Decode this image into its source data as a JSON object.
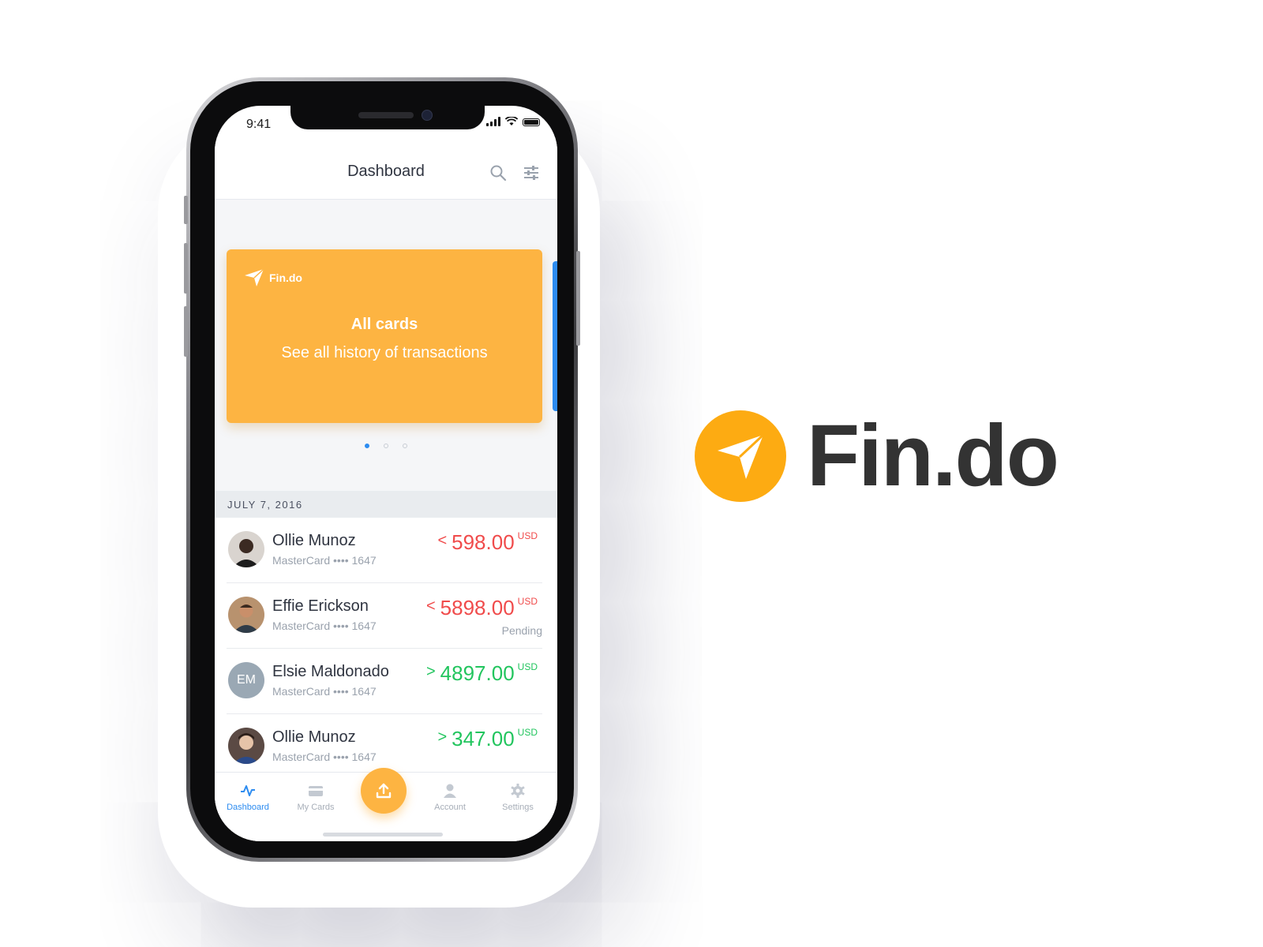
{
  "status_bar": {
    "time": "9:41"
  },
  "header": {
    "title": "Dashboard",
    "search_icon": "search-icon",
    "filter_icon": "sliders-icon"
  },
  "card": {
    "logo_text": "Fin.do",
    "title": "All cards",
    "subtitle": "See all history of transactions",
    "color": "#fdb442",
    "carousel_position": 1,
    "carousel_count": 3
  },
  "date_header": "JULY 7, 2016",
  "transactions": [
    {
      "name": "Ollie Munoz",
      "card": "MasterCard •••• 1647",
      "direction": "<",
      "amount": "598.00",
      "currency": "USD",
      "status": "",
      "type": "outgoing"
    },
    {
      "name": "Effie Erickson",
      "card": "MasterCard •••• 1647",
      "direction": "<",
      "amount": "5898.00",
      "currency": "USD",
      "status": "Pending",
      "type": "outgoing"
    },
    {
      "name": "Elsie Maldonado",
      "initials": "EM",
      "card": "MasterCard •••• 1647",
      "direction": ">",
      "amount": "4897.00",
      "currency": "USD",
      "status": "",
      "type": "incoming"
    },
    {
      "name": "Ollie Munoz",
      "card": "MasterCard •••• 1647",
      "direction": ">",
      "amount": "347.00",
      "currency": "USD",
      "status": "",
      "type": "incoming"
    }
  ],
  "tabbar": {
    "tabs": [
      {
        "label": "Dashboard",
        "icon": "activity-icon",
        "active": true
      },
      {
        "label": "My Cards",
        "icon": "card-icon",
        "active": false
      },
      {
        "label": "Account",
        "icon": "user-icon",
        "active": false
      },
      {
        "label": "Settings",
        "icon": "gear-icon",
        "active": false
      }
    ],
    "fab_icon": "upload-icon"
  },
  "brand": {
    "name": "Fin.do",
    "color": "#fdab12"
  },
  "colors": {
    "accent": "#2d8cf0",
    "negative": "#f04b4b",
    "positive": "#22c55e",
    "card": "#fdb442"
  }
}
